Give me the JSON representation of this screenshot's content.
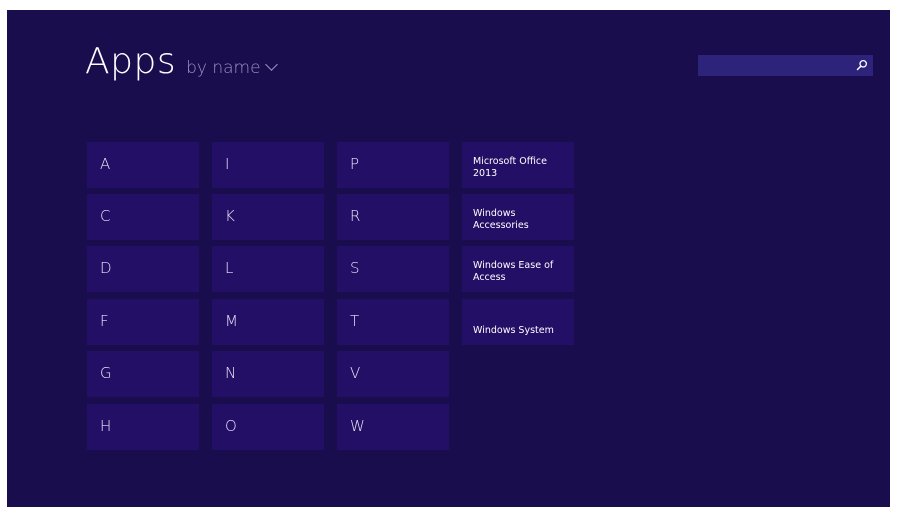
{
  "header": {
    "title": "Apps",
    "sort_label": "by name"
  },
  "search": {
    "placeholder": ""
  },
  "letters": [
    [
      "A",
      "C",
      "D",
      "F",
      "G",
      "H"
    ],
    [
      "I",
      "K",
      "L",
      "M",
      "N",
      "O"
    ],
    [
      "P",
      "R",
      "S",
      "T",
      "V",
      "W"
    ]
  ],
  "groups": [
    "Microsoft Office 2013",
    "Windows Accessories",
    "Windows Ease of Access",
    "Windows System"
  ],
  "colors": {
    "background": "#1a0d4d",
    "tile": "#240f67",
    "search_box": "#2e237a",
    "muted_text": "#9b93c4"
  }
}
